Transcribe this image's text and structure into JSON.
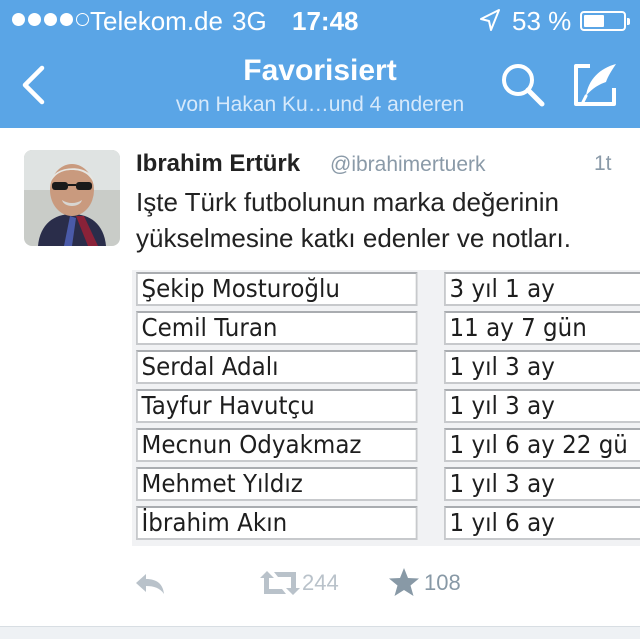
{
  "status_bar": {
    "carrier": "Telekom.de",
    "network": "3G",
    "time": "17:48",
    "battery": "53 %",
    "battery_level": 0.53
  },
  "nav": {
    "title": "Favorisiert",
    "subtitle": "von Hakan Ku…und 4 anderen",
    "accent_color": "#5aa5e6"
  },
  "tweet": {
    "name": "Ibrahim Ertürk",
    "handle": "@ibrahimertuerk",
    "age": "1t",
    "text": "Işte Türk futbolunun marka değerinin yükselmesine katkı edenler ve notları.",
    "image_table": [
      {
        "name": "Şekip Mosturoğlu",
        "duration": "3 yıl 1 ay"
      },
      {
        "name": "Cemil Turan",
        "duration": "11 ay 7 gün"
      },
      {
        "name": "Serdal Adalı",
        "duration": "1 yıl 3 ay"
      },
      {
        "name": "Tayfur Havutçu",
        "duration": "1 yıl 3 ay"
      },
      {
        "name": "Mecnun Odyakmaz",
        "duration": "1 yıl 6 ay 22 gü"
      },
      {
        "name": "Mehmet Yıldız",
        "duration": "1 yıl 3 ay"
      },
      {
        "name": "İbrahim Akın",
        "duration": "1 yıl 6 ay"
      }
    ],
    "retweets": "244",
    "favorites": "108"
  }
}
